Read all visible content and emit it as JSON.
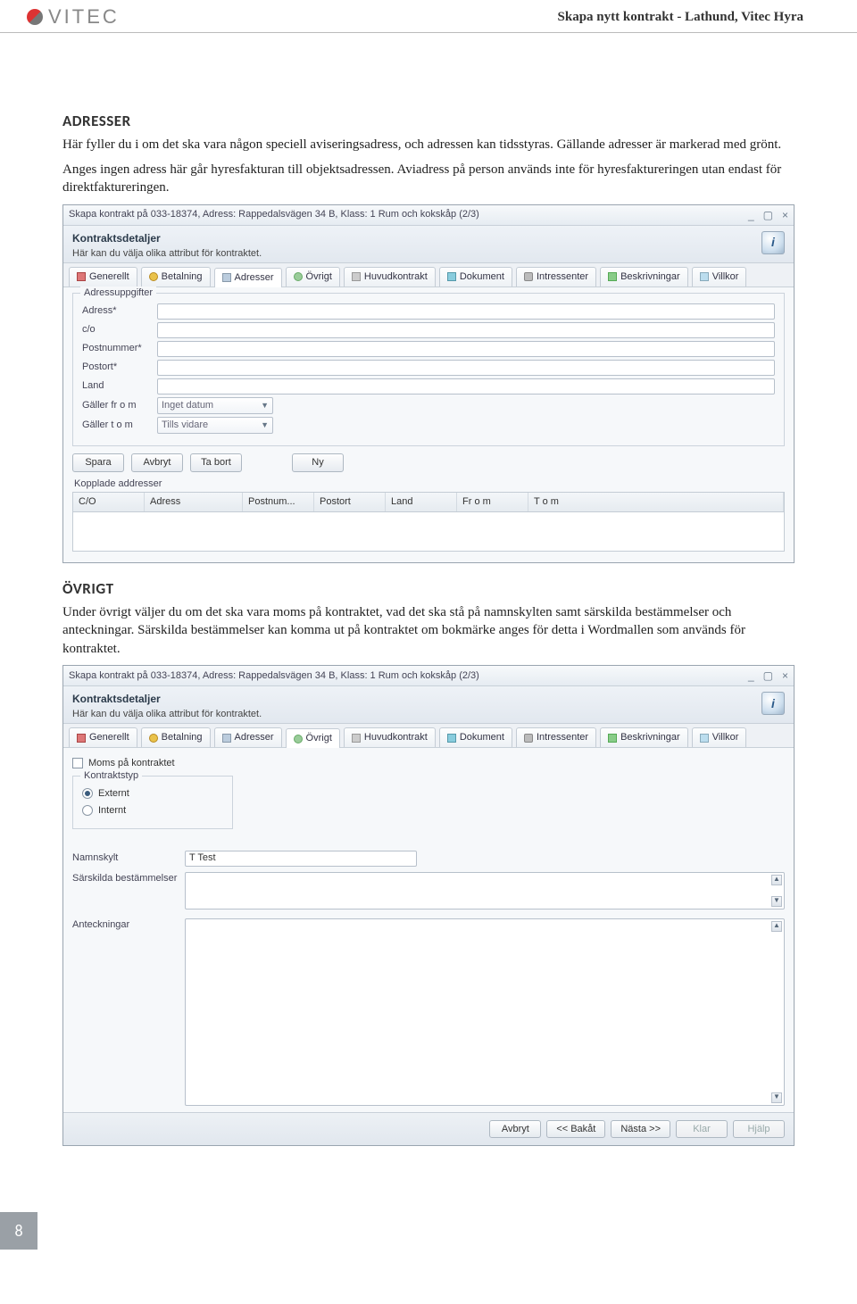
{
  "header": {
    "brand": "VITEC",
    "doc_title": "Skapa nytt kontrakt - Lathund, Vitec Hyra"
  },
  "section_adresser": {
    "title": "ADRESSER",
    "p1": "Här fyller du i om det ska vara någon speciell aviseringsadress, och adressen kan tidsstyras. Gällande adresser är markerad med grönt.",
    "p2": "Anges ingen adress här går hyresfakturan till objektsadressen. Aviadress på person används inte för hyresfaktureringen utan endast för direktfaktureringen."
  },
  "app1": {
    "title": "Skapa kontrakt på 033-18374, Adress: Rappedalsvägen 34 B, Klass: 1 Rum och kokskåp (2/3)",
    "panel_title": "Kontraktsdetaljer",
    "panel_sub": "Här kan du välja olika attribut för kontraktet.",
    "tabs": [
      "Generellt",
      "Betalning",
      "Adresser",
      "Övrigt",
      "Huvudkontrakt",
      "Dokument",
      "Intressenter",
      "Beskrivningar",
      "Villkor"
    ],
    "active_tab": "Adresser",
    "group_label": "Adressuppgifter",
    "fields": {
      "adress": "Adress*",
      "co": "c/o",
      "postnr": "Postnummer*",
      "postort": "Postort*",
      "land": "Land",
      "from": "Gäller fr o m",
      "tom": "Gäller t o m"
    },
    "combo_from": "Inget datum",
    "combo_tom": "Tills vidare",
    "buttons": {
      "spara": "Spara",
      "avbryt": "Avbryt",
      "tabort": "Ta bort",
      "ny": "Ny"
    },
    "linked_label": "Kopplade addresser",
    "grid_cols": [
      "C/O",
      "Adress",
      "Postnum...",
      "Postort",
      "Land",
      "Fr o m",
      "T o m"
    ]
  },
  "section_ovrigt": {
    "title": "ÖVRIGT",
    "p1": "Under övrigt väljer du om det ska vara moms på kontraktet, vad det ska stå på namnskylten samt särskilda bestämmelser och anteckningar. Särskilda bestämmelser kan komma ut på kontraktet om bokmärke anges för detta i Wordmallen som används för kontraktet."
  },
  "app2": {
    "title": "Skapa kontrakt på 033-18374, Adress: Rappedalsvägen 34 B, Klass: 1 Rum och kokskåp (2/3)",
    "panel_title": "Kontraktsdetaljer",
    "panel_sub": "Här kan du välja olika attribut för kontraktet.",
    "tabs": [
      "Generellt",
      "Betalning",
      "Adresser",
      "Övrigt",
      "Huvudkontrakt",
      "Dokument",
      "Intressenter",
      "Beskrivningar",
      "Villkor"
    ],
    "active_tab": "Övrigt",
    "moms_label": "Moms på kontraktet",
    "kontraktstyp_label": "Kontraktstyp",
    "radio_ext": "Externt",
    "radio_int": "Internt",
    "namnskylt_label": "Namnskylt",
    "namnskylt_value": "T Test",
    "sarskilda_label": "Särskilda bestämmelser",
    "anteckningar_label": "Anteckningar",
    "footer": {
      "avbryt": "Avbryt",
      "bakat": "<< Bakåt",
      "nasta": "Nästa >>",
      "klar": "Klar",
      "hjalp": "Hjälp"
    }
  },
  "page_number": "8"
}
